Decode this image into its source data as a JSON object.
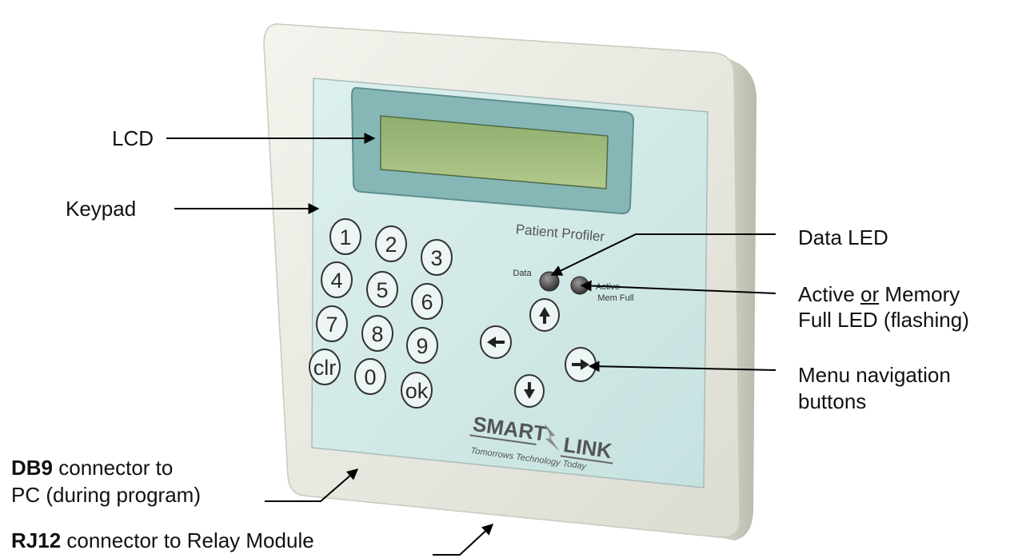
{
  "device": {
    "screen_label": "Patient Profiler",
    "led_left_label": "Data",
    "led_right_label_1": "Active",
    "led_right_label_2": "Mem Full",
    "keypad_keys": [
      "1",
      "2",
      "3",
      "4",
      "5",
      "6",
      "7",
      "8",
      "9",
      "clr",
      "0",
      "ok"
    ],
    "logo_line_1": "SMART",
    "logo_line_2": "LINK",
    "logo_tagline": "Tomorrows Technology Today"
  },
  "callouts": {
    "lcd": "LCD",
    "keypad": "Keypad",
    "data_led": "Data LED",
    "active_led_1": "Active",
    "active_led_or": "or",
    "active_led_2": "Memory",
    "active_led_3": "Full LED (flashing)",
    "menu_nav_1": "Menu navigation",
    "menu_nav_2": "buttons",
    "db9_bold": "DB9",
    "db9_rest": "connector to",
    "db9_line2": "PC (during program)",
    "rj12_bold": "RJ12",
    "rj12_rest": "connector to Relay Module"
  },
  "colors": {
    "case": "#eeeee6",
    "panel": "#d4ecea",
    "lcd_screen": "#9fb97e",
    "arrow": "#000000"
  }
}
